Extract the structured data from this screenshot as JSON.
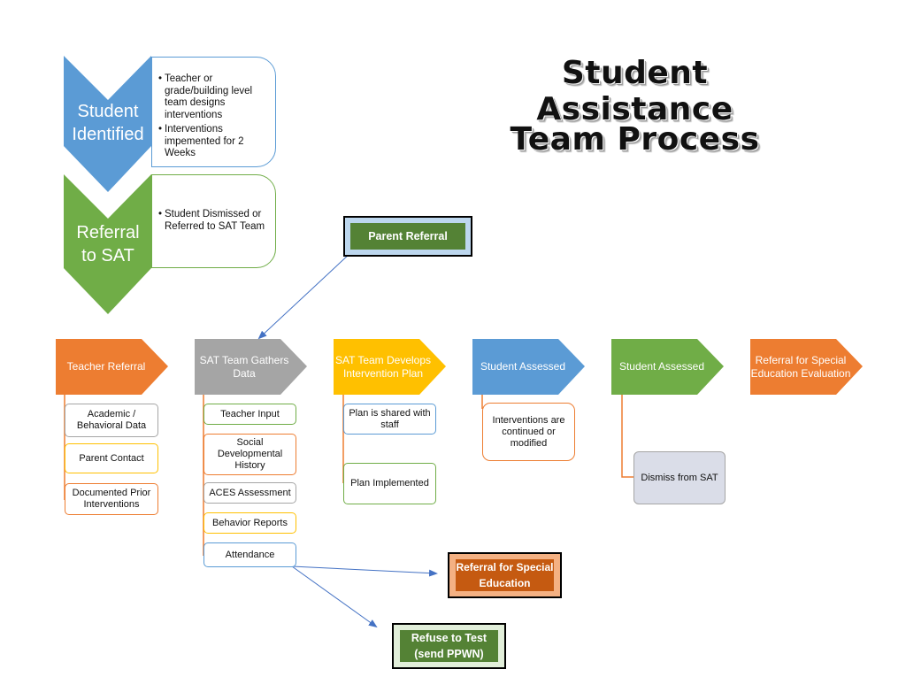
{
  "title": {
    "line1": "Student Assistance",
    "line2": "Team Process"
  },
  "colors": {
    "blue": "#5b9bd5",
    "green": "#70ad47",
    "orange": "#ed7d31",
    "gray": "#a5a5a5",
    "gold": "#ffc000",
    "dark_green": "#548235",
    "dark_orange": "#c55a11",
    "connector_blue": "#4472c4"
  },
  "top_steps": [
    {
      "label_line1": "Student",
      "label_line2": "Identified",
      "bullets": [
        "Teacher or grade/building level team designs interventions",
        "Interventions impemented for 2 Weeks"
      ]
    },
    {
      "label_line1": "Referral",
      "label_line2": "to SAT",
      "bullets": [
        "Student Dismissed or Referred to SAT Team"
      ]
    }
  ],
  "callouts": {
    "parent_referral": "Parent Referral",
    "referral_special_ed": "Referral for Special Education",
    "refuse_to_test": "Refuse to Test (send PPWN)"
  },
  "process": [
    {
      "label": "Teacher Referral",
      "children": [
        "Academic / Behavioral Data",
        "Parent Contact",
        "Documented Prior Interventions"
      ]
    },
    {
      "label": "SAT Team Gathers Data",
      "children": [
        "Teacher Input",
        "Social Developmental History",
        "ACES Assessment",
        "Behavior Reports",
        "Attendance"
      ]
    },
    {
      "label": "SAT Team Develops Intervention Plan",
      "children": [
        "Plan is shared with staff",
        "Plan Implemented"
      ]
    },
    {
      "label": "Student Assessed",
      "children": [
        "Interventions are continued or modified"
      ]
    },
    {
      "label": "Student Assessed",
      "children": [
        "Dismiss from SAT"
      ]
    },
    {
      "label": "Referral for Special Education Evaluation",
      "children": []
    }
  ]
}
